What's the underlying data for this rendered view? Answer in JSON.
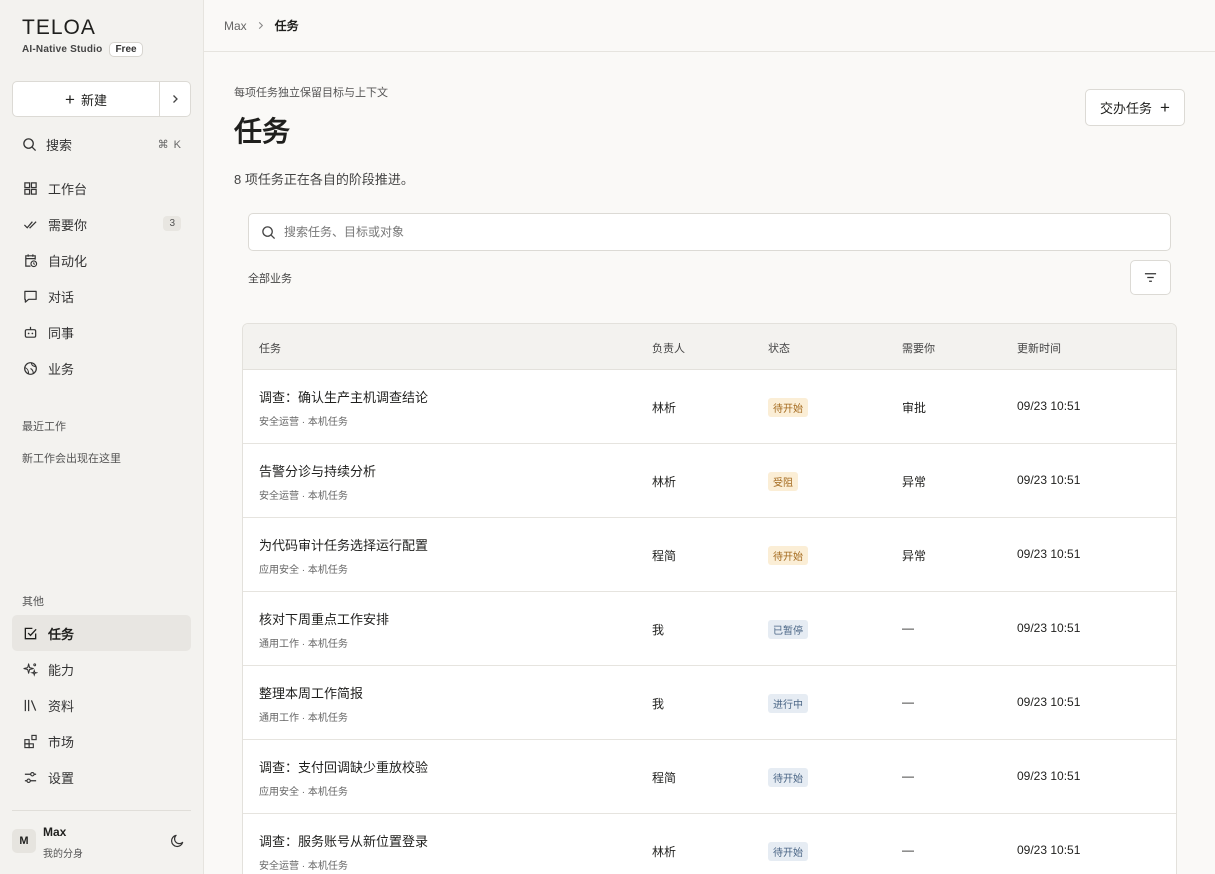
{
  "brand": {
    "logo": "TELOA",
    "tagline": "AI-Native Studio",
    "plan": "Free"
  },
  "sidebar": {
    "new_label": "新建",
    "search_label": "搜索",
    "search_shortcut": "⌘ K",
    "nav": [
      {
        "label": "工作台",
        "icon": "grid-icon"
      },
      {
        "label": "需要你",
        "icon": "double-check-icon",
        "badge": "3"
      },
      {
        "label": "自动化",
        "icon": "calendar-clock-icon"
      },
      {
        "label": "对话",
        "icon": "chat-icon"
      },
      {
        "label": "同事",
        "icon": "robot-icon"
      },
      {
        "label": "业务",
        "icon": "globe-icon"
      }
    ],
    "recent_label": "最近工作",
    "recent_empty": "新工作会出现在这里",
    "other_label": "其他",
    "other_nav": [
      {
        "label": "任务",
        "icon": "checkbox-icon",
        "active": true
      },
      {
        "label": "能力",
        "icon": "sparkle-icon"
      },
      {
        "label": "资料",
        "icon": "library-icon"
      },
      {
        "label": "市场",
        "icon": "blocks-icon"
      },
      {
        "label": "设置",
        "icon": "sliders-icon"
      }
    ],
    "user": {
      "initial": "M",
      "name": "Max",
      "subtitle": "我的分身"
    }
  },
  "breadcrumb": {
    "root": "Max",
    "current": "任务"
  },
  "header": {
    "eyebrow": "每项任务独立保留目标与上下文",
    "title": "任务",
    "summary": "8 项任务正在各自的阶段推进。",
    "delegate_label": "交办任务"
  },
  "search": {
    "placeholder": "搜索任务、目标或对象",
    "value": ""
  },
  "filter": {
    "label": "全部业务"
  },
  "table": {
    "columns": [
      "任务",
      "负责人",
      "状态",
      "需要你",
      "更新时间"
    ],
    "rows": [
      {
        "title": "调查：确认生产主机调查结论",
        "meta": "安全运营 · 本机任务",
        "owner": "林析",
        "status": "待开始",
        "status_kind": "pending",
        "need": "审批",
        "updated": "09/23 10:51"
      },
      {
        "title": "告警分诊与持续分析",
        "meta": "安全运营 · 本机任务",
        "owner": "林析",
        "status": "受阻",
        "status_kind": "blocked",
        "need": "异常",
        "updated": "09/23 10:51"
      },
      {
        "title": "为代码审计任务选择运行配置",
        "meta": "应用安全 · 本机任务",
        "owner": "程简",
        "status": "待开始",
        "status_kind": "pending",
        "need": "异常",
        "updated": "09/23 10:51"
      },
      {
        "title": "核对下周重点工作安排",
        "meta": "通用工作 · 本机任务",
        "owner": "我",
        "status": "已暂停",
        "status_kind": "paused",
        "need": "—",
        "updated": "09/23 10:51"
      },
      {
        "title": "整理本周工作简报",
        "meta": "通用工作 · 本机任务",
        "owner": "我",
        "status": "进行中",
        "status_kind": "running",
        "need": "—",
        "updated": "09/23 10:51"
      },
      {
        "title": "调查：支付回调缺少重放校验",
        "meta": "应用安全 · 本机任务",
        "owner": "程简",
        "status": "待开始",
        "status_kind": "paused",
        "need": "—",
        "updated": "09/23 10:51"
      },
      {
        "title": "调查：服务账号从新位置登录",
        "meta": "安全运营 · 本机任务",
        "owner": "林析",
        "status": "待开始",
        "status_kind": "paused",
        "need": "—",
        "updated": "09/23 10:51"
      }
    ]
  }
}
